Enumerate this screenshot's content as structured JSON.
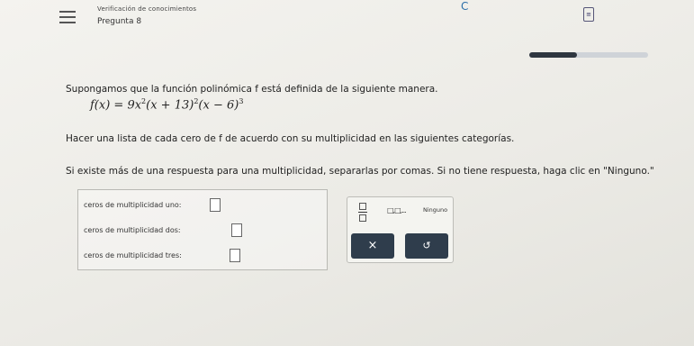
{
  "header": {
    "title": "Verificación de conocimientos",
    "subtitle": "Pregunta 8"
  },
  "progress": {
    "fraction": 0.4
  },
  "question": {
    "intro": "Supongamos que la función polinómica f está definida de la siguiente manera.",
    "formula": {
      "lhs": "f(x) = 9x",
      "exp1": "2",
      "mid1": "(x + 13)",
      "exp2": "2",
      "mid2": "(x − 6)",
      "exp3": "3"
    },
    "instruction": "Hacer una lista de cada cero de f de acuerdo con su multiplicidad en las siguientes categorías.",
    "note": "Si existe más de una respuesta para una multiplicidad, separarlas por comas. Si no tiene respuesta, haga clic en \"Ninguno.\""
  },
  "answers": [
    {
      "label": "ceros de multiplicidad uno:",
      "value": ""
    },
    {
      "label": "ceros de multiplicidad dos:",
      "value": ""
    },
    {
      "label": "ceros de multiplicidad tres:",
      "value": ""
    }
  ],
  "palette": {
    "list_label": "□,□,...",
    "none_label": "Ninguno",
    "clear_symbol": "×",
    "undo_symbol": "↺"
  },
  "icons": {
    "menu": "menu-icon",
    "refresh": "refresh-icon",
    "calculator": "calculator-icon",
    "fraction": "fraction-icon"
  },
  "colors": {
    "button_bg": "#2f3d4c",
    "accent": "#2b6fa8"
  }
}
